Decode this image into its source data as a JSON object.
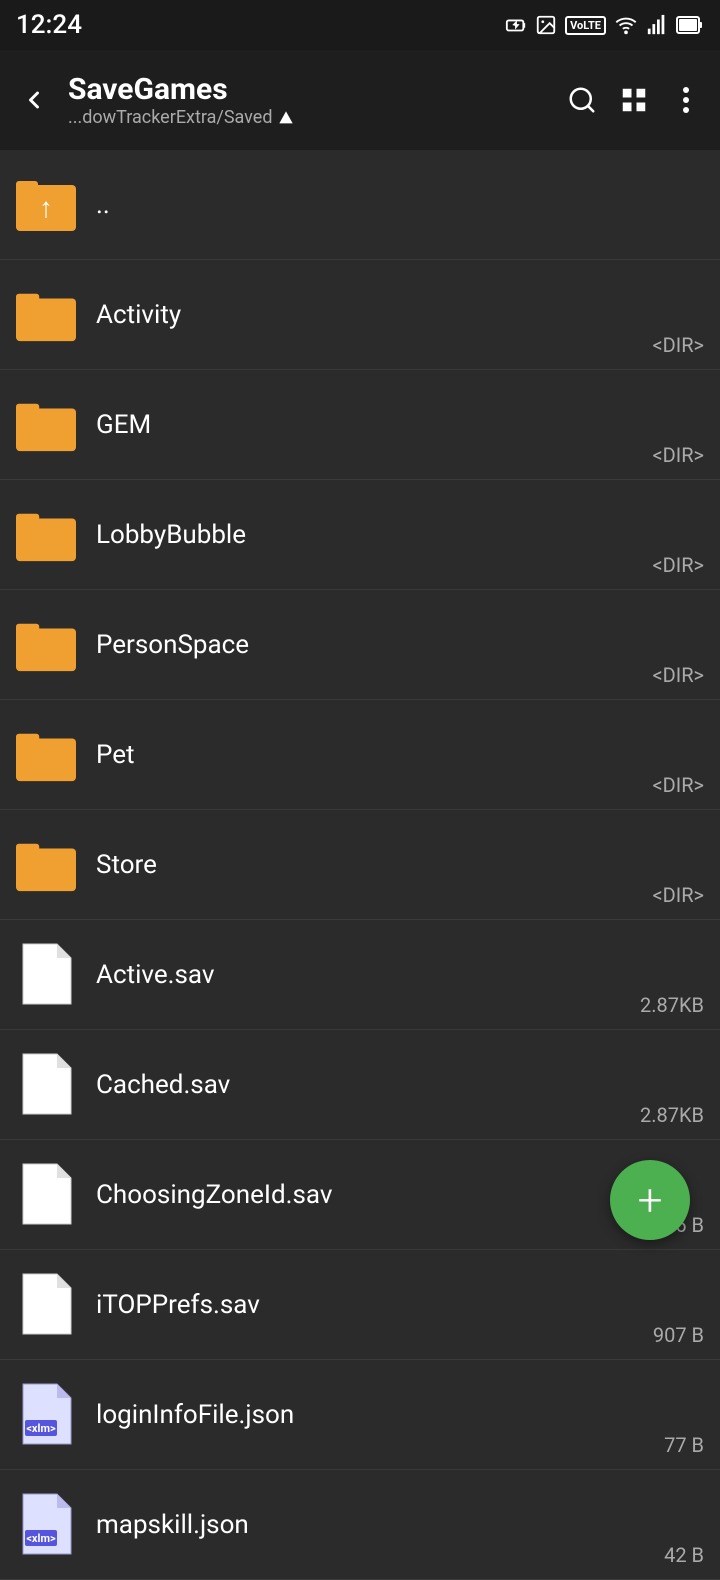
{
  "statusBar": {
    "time": "12:24",
    "icons": [
      "battery-icon",
      "sim-icon",
      "photo-icon",
      "volte-badge",
      "wifi-icon",
      "signal-icon",
      "battery-full-icon"
    ]
  },
  "appBar": {
    "title": "SaveGames",
    "subtitle": "...dowTrackerExtra/Saved",
    "backLabel": "←",
    "actions": {
      "search": "🔍",
      "grid": "⊞",
      "more": "⋮"
    }
  },
  "files": [
    {
      "name": "..",
      "type": "parent",
      "size": ""
    },
    {
      "name": "Activity",
      "type": "folder",
      "size": "<DIR>"
    },
    {
      "name": "GEM",
      "type": "folder",
      "size": "<DIR>"
    },
    {
      "name": "LobbyBubble",
      "type": "folder",
      "size": "<DIR>"
    },
    {
      "name": "PersonSpace",
      "type": "folder",
      "size": "<DIR>"
    },
    {
      "name": "Pet",
      "type": "folder",
      "size": "<DIR>"
    },
    {
      "name": "Store",
      "type": "folder",
      "size": "<DIR>"
    },
    {
      "name": "Active.sav",
      "type": "file",
      "size": "2.87KB"
    },
    {
      "name": "Cached.sav",
      "type": "file",
      "size": "2.87KB"
    },
    {
      "name": "ChoosingZoneId.sav",
      "type": "file",
      "size": "776 B"
    },
    {
      "name": "iTOPPrefs.sav",
      "type": "file",
      "size": "907 B"
    },
    {
      "name": "loginInfoFile.json",
      "type": "xml-file",
      "size": "77 B"
    },
    {
      "name": "mapskill.json",
      "type": "xml-file",
      "size": "42 B"
    }
  ],
  "fab": {
    "label": "+"
  }
}
